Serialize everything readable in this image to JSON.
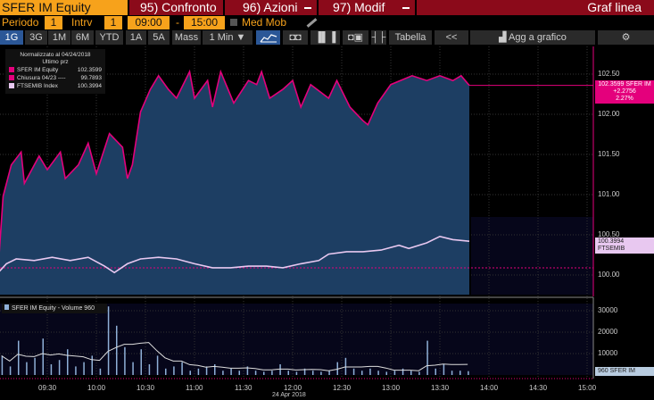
{
  "header": {
    "ticker": "SFER IM Equity",
    "compare": "95) Confronto",
    "actions": "96) Azioni",
    "modify": "97) Modif",
    "chart_type": "Graf linea"
  },
  "controls": {
    "period_label": "Periodo",
    "period_value": "1",
    "interval_label": "Intrv",
    "interval_value": "1",
    "start_time": "09:00",
    "dash": "-",
    "end_time": "15:00",
    "moving_avg_label": "Med Mob"
  },
  "toolbar": {
    "ranges": [
      "1G",
      "3G",
      "1M",
      "6M",
      "YTD",
      "1A",
      "5A",
      "Mass"
    ],
    "active_range": "1G",
    "interval_select": "1 Min ▼",
    "table_label": "Tabella",
    "collapse_label": "<<",
    "add_chart_label": "Agg a grafico"
  },
  "legend": {
    "title": "Normalizzato al 04/24/2018",
    "subtitle": "Ultimo prz",
    "items": [
      {
        "label": "SFER IM Equity",
        "value": "102.3599",
        "color": "#e4007c"
      },
      {
        "label": "Chiusura 04/23 ----",
        "value": "99.7893",
        "color": "#e4007c"
      },
      {
        "label": "FTSEMIB Index",
        "value": "100.3994",
        "color": "#e8c8f0"
      }
    ]
  },
  "tags": {
    "sfer_line1": "102.3599 SFER IM",
    "sfer_line2": "+2.2756",
    "sfer_line3": "2.27%",
    "ftse": "100.3994 FTSEMIB",
    "volume": "960 SFER IM"
  },
  "volume_legend": "SFER IM Equity - Volume 960",
  "date_label": "24 Apr 2018",
  "chart_data": {
    "type": "line",
    "x_unit": "minutes after 09:00",
    "price_axis": {
      "ticks": [
        "102.50",
        "102.00",
        "101.50",
        "101.00",
        "100.50",
        "100.00"
      ],
      "range": [
        99.75,
        102.55
      ]
    },
    "volume_axis": {
      "ticks": [
        "30000",
        "20000",
        "10000"
      ],
      "range": [
        0,
        35000
      ]
    },
    "time_ticks": [
      "09:30",
      "10:00",
      "10:30",
      "11:00",
      "11:30",
      "12:00",
      "12:30",
      "13:00",
      "13:30",
      "14:00",
      "14:30",
      "15:00"
    ],
    "series": [
      {
        "name": "SFER IM Equity",
        "color": "#e4007c",
        "points": [
          [
            0,
            100.09
          ],
          [
            3,
            100.98
          ],
          [
            8,
            101.37
          ],
          [
            14,
            101.53
          ],
          [
            16,
            101.14
          ],
          [
            25,
            101.48
          ],
          [
            30,
            101.31
          ],
          [
            38,
            101.53
          ],
          [
            41,
            101.2
          ],
          [
            49,
            101.37
          ],
          [
            55,
            101.64
          ],
          [
            60,
            101.26
          ],
          [
            68,
            101.76
          ],
          [
            76,
            101.59
          ],
          [
            79,
            101.2
          ],
          [
            82,
            101.37
          ],
          [
            87,
            102.03
          ],
          [
            93,
            102.31
          ],
          [
            98,
            102.48
          ],
          [
            104,
            102.31
          ],
          [
            109,
            102.2
          ],
          [
            117,
            102.53
          ],
          [
            120,
            102.2
          ],
          [
            128,
            102.42
          ],
          [
            131,
            102.09
          ],
          [
            136,
            102.53
          ],
          [
            144,
            102.14
          ],
          [
            153,
            102.42
          ],
          [
            158,
            102.37
          ],
          [
            161,
            102.53
          ],
          [
            166,
            102.2
          ],
          [
            174,
            102.31
          ],
          [
            180,
            102.42
          ],
          [
            185,
            102.09
          ],
          [
            191,
            102.37
          ],
          [
            202,
            102.2
          ],
          [
            207,
            102.42
          ],
          [
            215,
            102.09
          ],
          [
            223,
            101.92
          ],
          [
            226,
            101.87
          ],
          [
            232,
            102.14
          ],
          [
            240,
            102.37
          ],
          [
            253,
            102.48
          ],
          [
            262,
            102.42
          ],
          [
            270,
            102.48
          ],
          [
            278,
            102.42
          ],
          [
            283,
            102.48
          ],
          [
            288,
            102.36
          ]
        ]
      },
      {
        "name": "FTSEMIB Index",
        "color": "#e8c8f0",
        "points": [
          [
            0,
            100.03
          ],
          [
            5,
            100.14
          ],
          [
            11,
            100.2
          ],
          [
            22,
            100.18
          ],
          [
            33,
            100.22
          ],
          [
            44,
            100.18
          ],
          [
            55,
            100.22
          ],
          [
            65,
            100.11
          ],
          [
            71,
            100.03
          ],
          [
            79,
            100.14
          ],
          [
            87,
            100.2
          ],
          [
            98,
            100.22
          ],
          [
            109,
            100.2
          ],
          [
            120,
            100.14
          ],
          [
            131,
            100.09
          ],
          [
            142,
            100.09
          ],
          [
            153,
            100.11
          ],
          [
            164,
            100.11
          ],
          [
            174,
            100.09
          ],
          [
            185,
            100.14
          ],
          [
            196,
            100.18
          ],
          [
            202,
            100.26
          ],
          [
            213,
            100.29
          ],
          [
            223,
            100.29
          ],
          [
            234,
            100.31
          ],
          [
            245,
            100.37
          ],
          [
            251,
            100.33
          ],
          [
            262,
            100.4
          ],
          [
            270,
            100.48
          ],
          [
            278,
            100.44
          ],
          [
            288,
            100.42
          ]
        ]
      }
    ],
    "volume": {
      "interval_minutes": 5,
      "values": [
        9000,
        4000,
        16000,
        6000,
        8000,
        17000,
        5000,
        7000,
        12000,
        4000,
        6000,
        9000,
        3000,
        32000,
        23000,
        13000,
        6000,
        12000,
        5000,
        9000,
        3000,
        4000,
        6000,
        2000,
        3000,
        4000,
        5000,
        2000,
        3000,
        2000,
        4000,
        2000,
        1500,
        2000,
        5000,
        2000,
        1500,
        3000,
        2000,
        1500,
        2000,
        6000,
        8000,
        3000,
        2000,
        3000,
        2000,
        1500,
        2000,
        3000,
        2000,
        1500,
        16000,
        3000,
        5000,
        2000,
        2000,
        1800
      ]
    }
  }
}
